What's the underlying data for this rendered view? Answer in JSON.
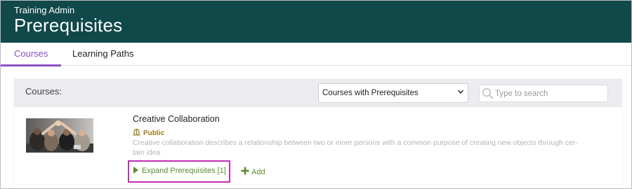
{
  "header": {
    "app_title": "Training Admin",
    "page_title": "Prerequisites"
  },
  "tabs": [
    {
      "label": "Courses",
      "active": true
    },
    {
      "label": "Learning Paths",
      "active": false
    }
  ],
  "courses_panel": {
    "label": "Courses:",
    "filter": {
      "selected": "Courses with Prerequisites"
    },
    "search": {
      "placeholder": "Type to search"
    }
  },
  "course": {
    "title": "Creative Collaboration",
    "visibility": "Public",
    "description": "Creative collaboration describes a relationship between two or more persons with a common purpose of creating new objects through cer-tain idea",
    "expand_label": "Expand Prerequisites [1]",
    "add_label": "Add"
  },
  "colors": {
    "header_bg": "#11484a",
    "accent_purple": "#8a4fc2",
    "action_green": "#5c8b2d",
    "public_gold": "#9a7a1a",
    "highlight_magenta": "#c12fb2"
  }
}
